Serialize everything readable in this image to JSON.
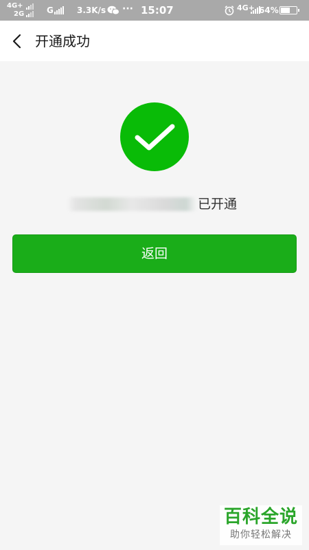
{
  "status_bar": {
    "network_1": "4G+",
    "network_2": "2G",
    "network_3": "G",
    "speed": "3.3K/s",
    "more": "···",
    "time": "15:07",
    "network_4": "4G+",
    "battery_percent": "64%",
    "battery_level": 0.64,
    "icons": [
      "signal-icon",
      "wechat-icon",
      "alarm-icon",
      "battery-icon"
    ]
  },
  "nav": {
    "back_icon": "chevron-left-icon",
    "title": "开通成功"
  },
  "main": {
    "success_icon": "check-circle-icon",
    "success_color": "#09bb07",
    "status_text": "已开通",
    "button_label": "返回",
    "button_color": "#1aad19"
  },
  "watermark": {
    "title": "百科全说",
    "subtitle": "助你轻松解决"
  }
}
